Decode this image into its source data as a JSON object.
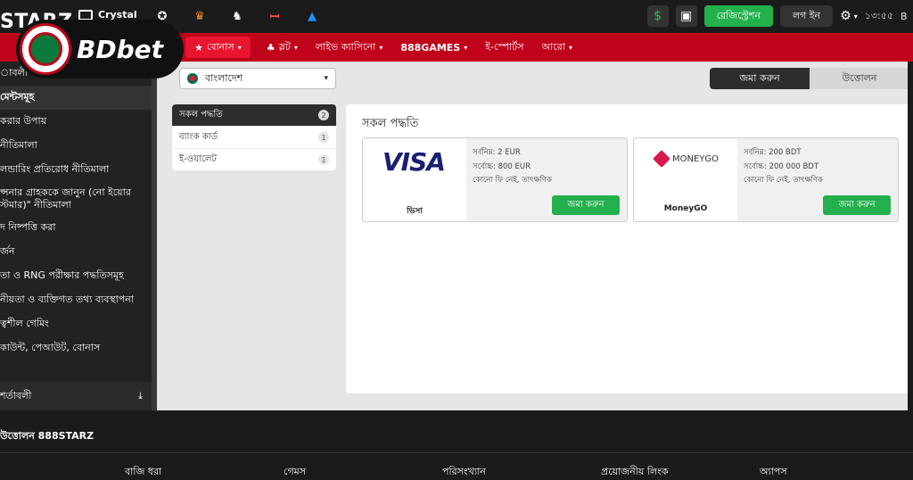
{
  "topbar": {
    "brand": "STARZ",
    "crystal": "Crystal",
    "sponsors": [
      {
        "icon": "champions-league-icon",
        "color": "#ffffff"
      },
      {
        "icon": "europa-league-icon",
        "color": "#f28c28"
      },
      {
        "icon": "premier-league-icon",
        "color": "#ffffff"
      },
      {
        "icon": "laliga-icon",
        "color": "#ff4b44"
      },
      {
        "icon": "serie-a-icon",
        "color": "#1e90ff"
      }
    ],
    "register": "রেজিস্ট্রেশন",
    "login": "লগ ইন",
    "time": "১৩:৫৫",
    "lang": "B"
  },
  "logo": {
    "text": "BDbet"
  },
  "nav": [
    {
      "label": "বোনাস",
      "icon": "star-icon",
      "active": true
    },
    {
      "label": "স্লট",
      "icon": "cherry-icon",
      "active": false
    },
    {
      "label": "লাইভ ক্যাসিনো",
      "active": false
    },
    {
      "label": "888GAMES",
      "active": false
    },
    {
      "label": "ই-স্পোর্টস",
      "active": false,
      "nochev": true
    },
    {
      "label": "আরো",
      "active": false
    }
  ],
  "sidebar": {
    "items": [
      {
        "label": "াবলী"
      },
      {
        "label": "মেন্টসমূহ",
        "active": true
      },
      {
        "label": "করার উপায়"
      },
      {
        "label": "নীতিমালা"
      },
      {
        "label": "লন্ডারিং প্রতিরোধ নীতিমালা"
      },
      {
        "label": "প্সনার গ্রাহককে জানুন (নো ইয়োর স্টমার)\" নীতিমালা",
        "multi": true
      },
      {
        "label": "দ নিষ্পত্তি করা"
      },
      {
        "label": "র্জন"
      },
      {
        "label": "তা ও RNG পরীক্ষার পদ্ধতিসমূহ"
      },
      {
        "label": "নীয়তা ও ব্যক্তিগত তথ্য ব্যবস্থাপনা"
      },
      {
        "label": "ত্বশীল গেমিং"
      },
      {
        "label": "কাউন্ট, পেআউট, বোনাস"
      }
    ],
    "bottom": "শর্তাবলী"
  },
  "main": {
    "country": "বাংলাদেশ",
    "toggle": {
      "deposit": "জমা করুন",
      "withdraw": "উত্তোলন"
    },
    "methods": [
      {
        "label": "সকল পদ্ধতি",
        "count": "2",
        "selected": true
      },
      {
        "label": "ব্যাংক কার্ড",
        "count": "1"
      },
      {
        "label": "ই-ওয়ালেট",
        "count": "1"
      }
    ],
    "title": "সকল পদ্ধতি",
    "cards": [
      {
        "name": "ভিসা",
        "logo": "VISA",
        "min": "সর্বনিম্ন: 2 EUR",
        "max": "সর্বোচ্চ: 800 EUR",
        "fee": "কোনো ফি নেই, তাৎক্ষণিক",
        "button": "জমা করুন"
      },
      {
        "name": "MoneyGO",
        "logo": "MONEYGO",
        "min": "সর্বনিম্ন: 200 BDT",
        "max": "সর্বোচ্চ: 200 000 BDT",
        "fee": "কোনো ফি নেই, তাৎক্ষণিক",
        "button": "জমা করুন"
      }
    ]
  },
  "footer": {
    "heading": "উত্তোলন 888STARZ",
    "columns": [
      "বাজি ধরা",
      "গেমস",
      "পরিসংখ্যান",
      "প্রয়োজনীয় লিংক",
      "অ্যাপস"
    ]
  }
}
